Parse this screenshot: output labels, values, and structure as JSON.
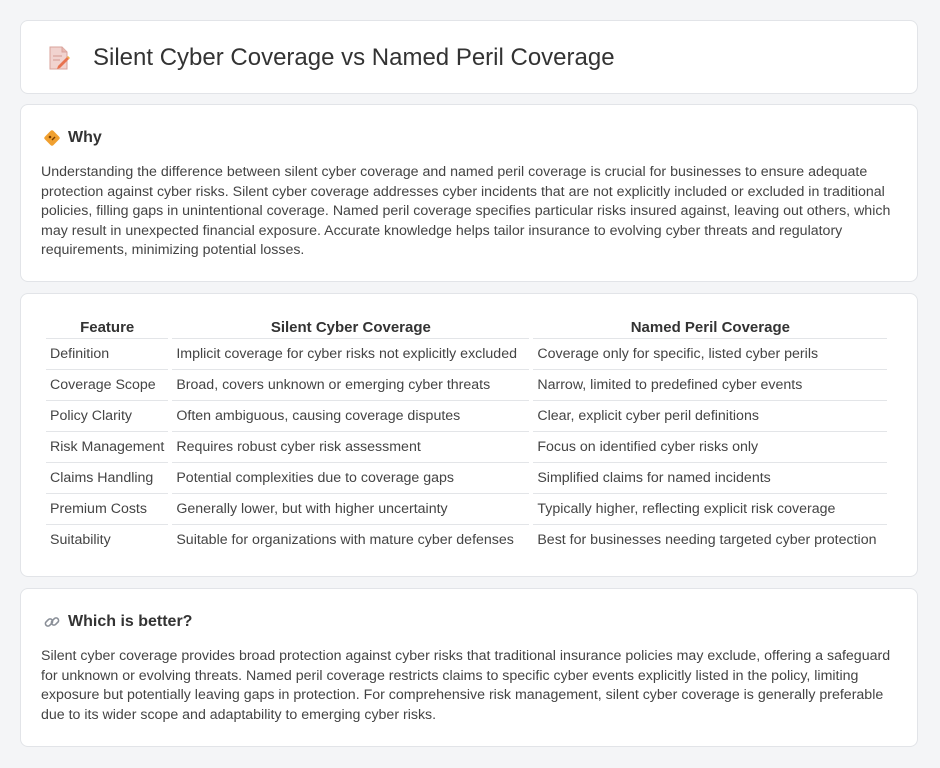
{
  "header": {
    "title": "Silent Cyber Coverage vs Named Peril Coverage",
    "icon": "document-edit-icon"
  },
  "why": {
    "heading": "Why",
    "icon": "diamond-sign-icon",
    "text": "Understanding the difference between silent cyber coverage and named peril coverage is crucial for businesses to ensure adequate protection against cyber risks. Silent cyber coverage addresses cyber incidents that are not explicitly included or excluded in traditional policies, filling gaps in unintentional coverage. Named peril coverage specifies particular risks insured against, leaving out others, which may result in unexpected financial exposure. Accurate knowledge helps tailor insurance to evolving cyber threats and regulatory requirements, minimizing potential losses."
  },
  "comparison": {
    "headers": [
      "Feature",
      "Silent Cyber Coverage",
      "Named Peril Coverage"
    ],
    "rows": [
      [
        "Definition",
        "Implicit coverage for cyber risks not explicitly excluded",
        "Coverage only for specific, listed cyber perils"
      ],
      [
        "Coverage Scope",
        "Broad, covers unknown or emerging cyber threats",
        "Narrow, limited to predefined cyber events"
      ],
      [
        "Policy Clarity",
        "Often ambiguous, causing coverage disputes",
        "Clear, explicit cyber peril definitions"
      ],
      [
        "Risk Management",
        "Requires robust cyber risk assessment",
        "Focus on identified cyber risks only"
      ],
      [
        "Claims Handling",
        "Potential complexities due to coverage gaps",
        "Simplified claims for named incidents"
      ],
      [
        "Premium Costs",
        "Generally lower, but with higher uncertainty",
        "Typically higher, reflecting explicit risk coverage"
      ],
      [
        "Suitability",
        "Suitable for organizations with mature cyber defenses",
        "Best for businesses needing targeted cyber protection"
      ]
    ]
  },
  "better": {
    "heading": "Which is better?",
    "icon": "link-icon",
    "text": "Silent cyber coverage provides broad protection against cyber risks that traditional insurance policies may exclude, offering a safeguard for unknown or evolving threats. Named peril coverage restricts claims to specific cyber events explicitly listed in the policy, limiting exposure but potentially leaving gaps in protection. For comprehensive risk management, silent cyber coverage is generally preferable due to its wider scope and adaptability to emerging cyber risks."
  }
}
